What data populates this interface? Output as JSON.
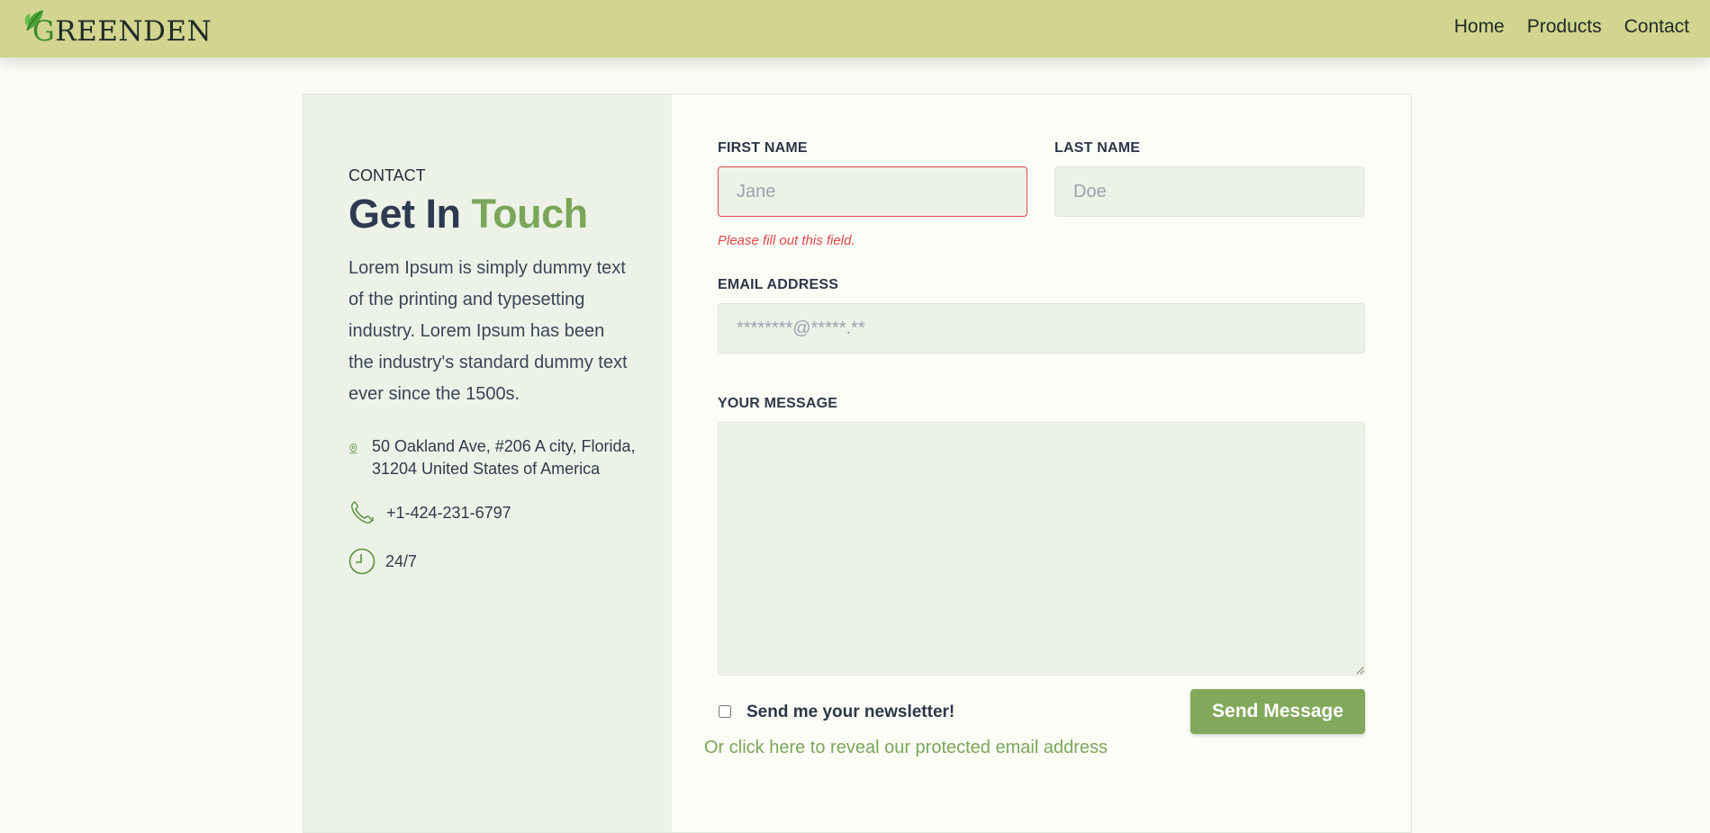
{
  "brand": {
    "logo_first": "G",
    "logo_rest": "REENDEN"
  },
  "nav": {
    "items": [
      "Home",
      "Products",
      "Contact"
    ]
  },
  "contact": {
    "tag": "CONTACT",
    "title_main": "Get In",
    "title_accent": "Touch",
    "description": "Lorem Ipsum is simply dummy text of the printing and typesetting industry. Lorem Ipsum has been the industry's standard dummy text ever since the 1500s.",
    "address_line1": "50 Oakland Ave, #206 A city, Florida,",
    "address_line2": "31204 United States of America",
    "phone": "+1-424-231-6797",
    "hours": "24/7"
  },
  "form": {
    "first_name": {
      "label": "FIRST NAME",
      "placeholder": "Jane",
      "value": "",
      "error": "Please fill out this field."
    },
    "last_name": {
      "label": "LAST NAME",
      "placeholder": "Doe",
      "value": ""
    },
    "email": {
      "label": "EMAIL ADDRESS",
      "placeholder": "********@*****.**",
      "value": ""
    },
    "message": {
      "label": "YOUR MESSAGE",
      "value": ""
    },
    "newsletter": {
      "label": "Send me your newsletter!",
      "checked": false
    },
    "submit_label": "Send Message",
    "reveal_link": "Or click here to reveal our protected email address"
  },
  "colors": {
    "header_bg": "#d2d48f",
    "accent_green": "#7ba65a",
    "button_green": "#82a85c",
    "error_red": "#e0474b",
    "panel_bg": "#edf2e8",
    "page_bg": "#fafcf5"
  },
  "icons": {
    "logo": "leaf-icon",
    "address": "map-pin-icon",
    "phone": "phone-icon",
    "hours": "clock-icon"
  }
}
